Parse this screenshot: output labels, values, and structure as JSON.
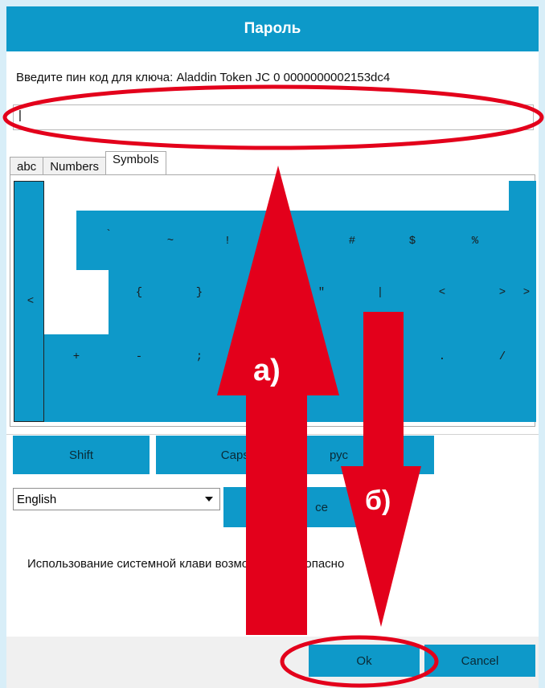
{
  "dialog": {
    "title": "Пароль",
    "prompt": "Введите пин код для ключа: Aladdin Token JC 0 0000000002153dc4",
    "pin_value": "|"
  },
  "tabs": [
    {
      "label": "abc",
      "active": false
    },
    {
      "label": "Numbers",
      "active": false
    },
    {
      "label": "Symbols",
      "active": true
    }
  ],
  "keyboard": {
    "row1": [
      "`",
      "~",
      "!",
      "#",
      "$",
      "%"
    ],
    "row2": [
      "<",
      "{",
      "}",
      "\"",
      "|",
      "<",
      ">",
      ">"
    ],
    "row3": [
      "+",
      "-",
      ";",
      ".",
      "/"
    ]
  },
  "controls": {
    "shift": "Shift",
    "capslock": "CapsLoc",
    "language_toggle": "рус",
    "backspace": "ce",
    "language_select": "English"
  },
  "warning": "Использование системной клави        возможно    небезопасно",
  "footer": {
    "ok": "Ok",
    "cancel": "Cancel"
  },
  "annotations": {
    "up_label": "а)",
    "down_label": "б)"
  },
  "colors": {
    "accent": "#0e99c9",
    "annotation": "#e3001b"
  }
}
